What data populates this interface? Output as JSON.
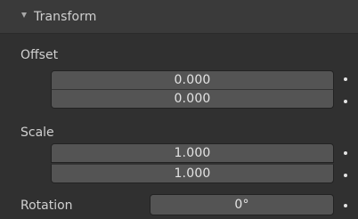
{
  "panel": {
    "title": "Transform"
  },
  "offset": {
    "label": "Offset",
    "x": "0.000",
    "y": "0.000"
  },
  "scale": {
    "label": "Scale",
    "x": "1.000",
    "y": "1.000"
  },
  "rotation": {
    "label": "Rotation",
    "value": "0°"
  },
  "icons": {
    "collapse": "chevron-down-icon",
    "keyframe": "keyframe-dot-icon"
  },
  "colors": {
    "background": "#303030",
    "header": "#3a3a3a",
    "field": "#545454",
    "text": "#d6d6d6"
  }
}
